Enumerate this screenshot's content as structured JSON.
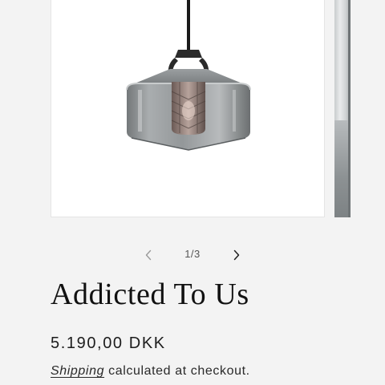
{
  "gallery": {
    "image_alt": "Addicted To Us pendant lamp",
    "counter": "1/3",
    "prev_icon": "chevron-left-icon",
    "next_icon": "chevron-right-icon"
  },
  "product": {
    "title": "Addicted To Us",
    "price": "5.190,00 DKK",
    "shipping_link": "Shipping",
    "shipping_text": " calculated at checkout."
  },
  "colors": {
    "background": "#f3f3f3",
    "card": "#ffffff",
    "text": "#1c1c1c"
  }
}
